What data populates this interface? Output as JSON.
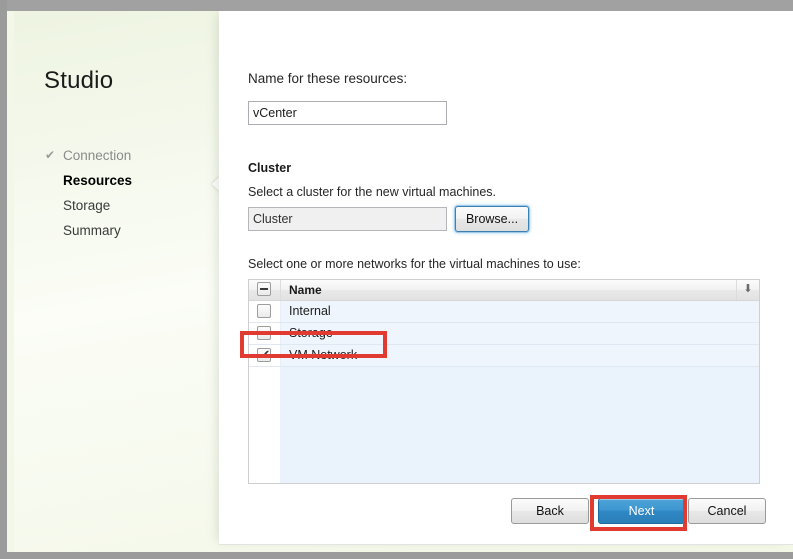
{
  "window": {
    "title": "",
    "frame_color": "#9b9b9b"
  },
  "sidebar": {
    "brand": "Studio",
    "steps": [
      {
        "label": "Connection",
        "state": "completed",
        "icon": "check-icon",
        "tick": "✔"
      },
      {
        "label": "Resources",
        "state": "current",
        "icon": "",
        "tick": ""
      },
      {
        "label": "Storage",
        "state": "pending",
        "icon": "",
        "tick": ""
      },
      {
        "label": "Summary",
        "state": "pending",
        "icon": "",
        "tick": ""
      }
    ]
  },
  "main": {
    "name_label": "Name for these resources:",
    "name_value": "vCenter",
    "name_placeholder": "",
    "cluster_heading": "Cluster",
    "cluster_helper": "Select a cluster for the new virtual machines.",
    "cluster_value": "Cluster",
    "browse_label": "Browse...",
    "networks_label": "Select one or more networks for the virtual machines to use:",
    "list": {
      "header_checkbox_state": "indeterminate",
      "column_name": "Name",
      "sort_icon": "⬇",
      "rows": [
        {
          "name": "Internal",
          "checked": false
        },
        {
          "name": "Storage",
          "checked": false
        },
        {
          "name": "VM Network",
          "checked": true
        }
      ]
    }
  },
  "footer": {
    "back_label": "Back",
    "next_label": "Next",
    "cancel_label": "Cancel"
  },
  "annotations": {
    "accent_color": "#e03a31",
    "boxes": [
      {
        "target": "vm-network-row"
      },
      {
        "target": "next-button"
      }
    ]
  }
}
